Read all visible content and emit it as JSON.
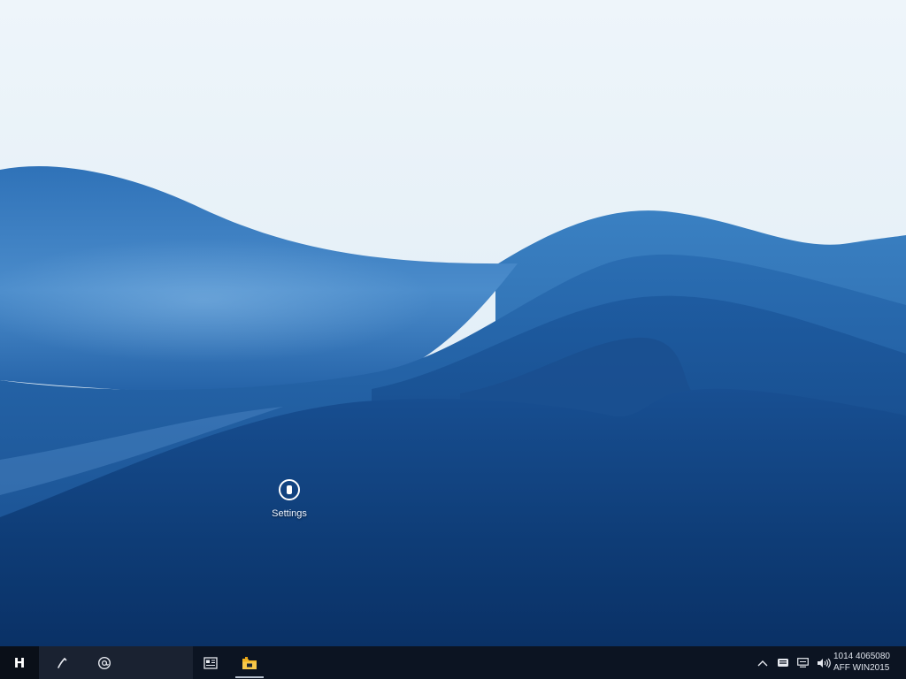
{
  "desktop": {
    "icons": [
      {
        "label": "Settings",
        "icon": "power-icon"
      }
    ]
  },
  "taskbar": {
    "start_label": "H",
    "pinned": [
      {
        "icon": "pen-icon"
      },
      {
        "icon": "at-sign-icon"
      },
      {
        "icon": "news-widgets-icon"
      },
      {
        "icon": "file-explorer-folder-icon",
        "active": true
      }
    ],
    "tray": {
      "icons": [
        "chevron-up-icon",
        "keyboard-icon",
        "display-icon",
        "volume-icon"
      ]
    },
    "clock": {
      "line1": "1014 4065080",
      "line2": "AFF WIN2015"
    }
  },
  "colors": {
    "taskbar_bg": "#0c1422",
    "sky": "#e9f2f9",
    "wave_dark": "#0d3a74",
    "wave_light": "#3a7fc3",
    "folder_accent": "#f2b321"
  }
}
